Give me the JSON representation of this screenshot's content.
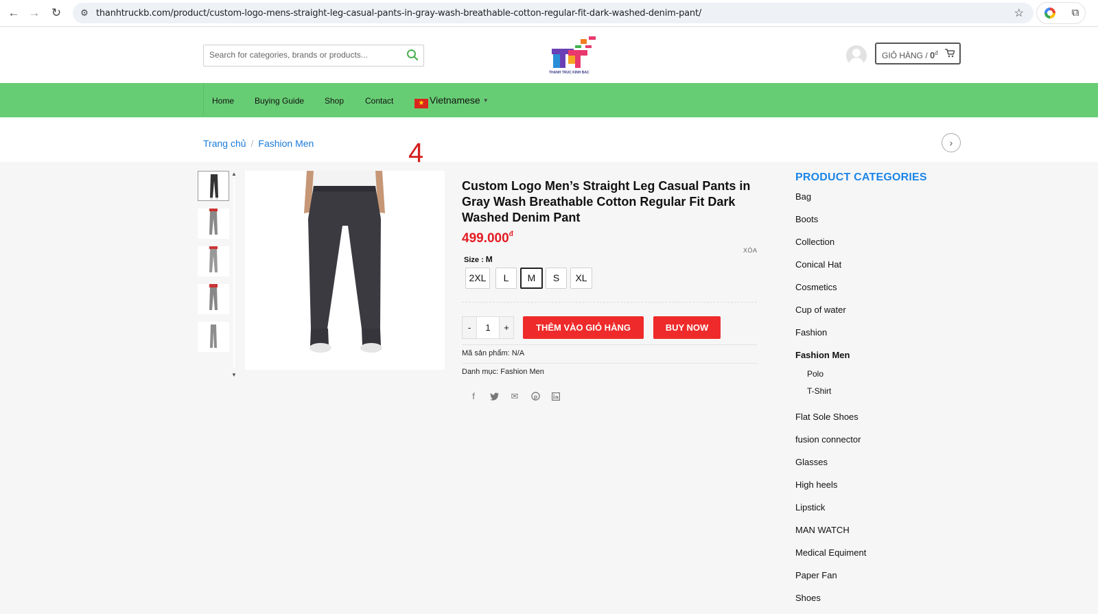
{
  "browser": {
    "url": "thanhtruckb.com/product/custom-logo-mens-straight-leg-casual-pants-in-gray-wash-breathable-cotton-regular-fit-dark-washed-denim-pant/"
  },
  "header": {
    "search_placeholder": "Search for categories, brands or products...",
    "logo_text": "THANH TRUC KINH BAC",
    "cart_label": "GIỎ HÀNG /",
    "cart_amount": "0",
    "cart_currency": "đ"
  },
  "nav": {
    "items": [
      "Home",
      "Buying Guide",
      "Shop",
      "Contact"
    ],
    "language": "Vietnamese"
  },
  "breadcrumb": {
    "home": "Trang chủ",
    "separator": "/",
    "category": "Fashion Men"
  },
  "marker": "4",
  "product": {
    "title": "Custom Logo Men’s Straight Leg Casual Pants in Gray Wash Breathable Cotton Regular Fit Dark Washed Denim Pant",
    "price": "499.000",
    "currency": "đ",
    "size_label": "Size :",
    "size_selected": "M",
    "clear_label": "XÓA",
    "sizes": [
      "2XL",
      "L",
      "M",
      "S",
      "XL"
    ],
    "quantity": "1",
    "qty_minus": "-",
    "qty_plus": "+",
    "add_to_cart": "THÊM VÀO GIỎ HÀNG",
    "buy_now": "BUY NOW",
    "sku_label": "Mã sản phẩm:",
    "sku_value": "N/A",
    "category_label": "Danh mục:",
    "category_value": "Fashion Men"
  },
  "sidebar": {
    "title": "PRODUCT CATEGORIES",
    "categories": [
      "Bag",
      "Boots",
      "Collection",
      "Conical Hat",
      "Cosmetics",
      "Cup of water",
      "Fashion",
      "Fashion Men",
      "Flat Sole Shoes",
      "fusion connector",
      "Glasses",
      "High heels",
      "Lipstick",
      "MAN WATCH",
      "Medical Equiment",
      "Paper Fan",
      "Shoes"
    ],
    "subcategories": [
      "Polo",
      "T-Shirt"
    ]
  },
  "colors": {
    "nav_green": "#67cd74",
    "price_red": "#e31b23",
    "button_red": "#ee2a2a",
    "link_blue": "#1a7ad8",
    "category_title_blue": "#1a85e8"
  }
}
